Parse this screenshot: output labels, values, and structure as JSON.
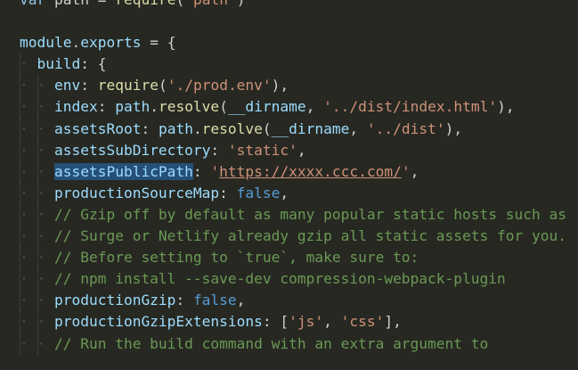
{
  "editor": {
    "theme_colors": {
      "background": "#272822",
      "property": "#9cdcfe",
      "string": "#ce9178",
      "function": "#dcdcaa",
      "boolean": "#569cd6",
      "comment": "#6a9955",
      "selection": "#264f78"
    },
    "lines": [
      {
        "id": "l0",
        "tokens": [
          {
            "t": "var",
            "c": "kw"
          },
          {
            "t": " path ",
            "c": "op"
          },
          {
            "t": "= ",
            "c": "op"
          },
          {
            "t": "require",
            "c": "fn"
          },
          {
            "t": "('",
            "c": "punc"
          },
          {
            "t": "path",
            "c": "str"
          },
          {
            "t": "')",
            "c": "punc"
          }
        ]
      },
      {
        "id": "l1",
        "tokens": []
      },
      {
        "id": "l2",
        "tokens": [
          {
            "t": "module",
            "c": "prop"
          },
          {
            "t": ".",
            "c": "punc"
          },
          {
            "t": "exports",
            "c": "prop"
          },
          {
            "t": " = {",
            "c": "op"
          }
        ]
      },
      {
        "id": "l3",
        "indent": 1,
        "tokens": [
          {
            "t": "build",
            "c": "prop"
          },
          {
            "t": ": {",
            "c": "punc"
          }
        ]
      },
      {
        "id": "l4",
        "indent": 2,
        "tokens": [
          {
            "t": "env",
            "c": "prop"
          },
          {
            "t": ": ",
            "c": "punc"
          },
          {
            "t": "require",
            "c": "fn"
          },
          {
            "t": "(",
            "c": "punc"
          },
          {
            "t": "'./prod.env'",
            "c": "str"
          },
          {
            "t": "),",
            "c": "punc"
          }
        ]
      },
      {
        "id": "l5",
        "indent": 2,
        "tokens": [
          {
            "t": "index",
            "c": "prop"
          },
          {
            "t": ": ",
            "c": "punc"
          },
          {
            "t": "path",
            "c": "prop"
          },
          {
            "t": ".",
            "c": "punc"
          },
          {
            "t": "resolve",
            "c": "fn"
          },
          {
            "t": "(",
            "c": "punc"
          },
          {
            "t": "__dirname",
            "c": "prop"
          },
          {
            "t": ", ",
            "c": "punc"
          },
          {
            "t": "'../dist/index.html'",
            "c": "str"
          },
          {
            "t": "),",
            "c": "punc"
          }
        ]
      },
      {
        "id": "l6",
        "indent": 2,
        "tokens": [
          {
            "t": "assetsRoot",
            "c": "prop"
          },
          {
            "t": ": ",
            "c": "punc"
          },
          {
            "t": "path",
            "c": "prop"
          },
          {
            "t": ".",
            "c": "punc"
          },
          {
            "t": "resolve",
            "c": "fn"
          },
          {
            "t": "(",
            "c": "punc"
          },
          {
            "t": "__dirname",
            "c": "prop"
          },
          {
            "t": ", ",
            "c": "punc"
          },
          {
            "t": "'../dist'",
            "c": "str"
          },
          {
            "t": "),",
            "c": "punc"
          }
        ]
      },
      {
        "id": "l7",
        "indent": 2,
        "tokens": [
          {
            "t": "assetsSubDirectory",
            "c": "prop"
          },
          {
            "t": ": ",
            "c": "punc"
          },
          {
            "t": "'static'",
            "c": "str"
          },
          {
            "t": ",",
            "c": "punc"
          }
        ]
      },
      {
        "id": "l8",
        "indent": 2,
        "tokens": [
          {
            "t": "assetsPublicPath",
            "c": "sel"
          },
          {
            "t": ": ",
            "c": "punc"
          },
          {
            "t": "'",
            "c": "str"
          },
          {
            "t": "https://xxxx.ccc.com/",
            "c": "url"
          },
          {
            "t": "'",
            "c": "str"
          },
          {
            "t": ",",
            "c": "punc"
          }
        ]
      },
      {
        "id": "l9",
        "indent": 2,
        "tokens": [
          {
            "t": "productionSourceMap",
            "c": "prop"
          },
          {
            "t": ": ",
            "c": "punc"
          },
          {
            "t": "false",
            "c": "bool"
          },
          {
            "t": ",",
            "c": "punc"
          }
        ]
      },
      {
        "id": "l10",
        "indent": 2,
        "tokens": [
          {
            "t": "// Gzip off by default as many popular static hosts such as",
            "c": "cmt"
          }
        ]
      },
      {
        "id": "l11",
        "indent": 2,
        "tokens": [
          {
            "t": "// Surge or Netlify already gzip all static assets for you.",
            "c": "cmt"
          }
        ]
      },
      {
        "id": "l12",
        "indent": 2,
        "tokens": [
          {
            "t": "// Before setting to `true`, make sure to:",
            "c": "cmt"
          }
        ]
      },
      {
        "id": "l13",
        "indent": 2,
        "tokens": [
          {
            "t": "// npm install --save-dev compression-webpack-plugin",
            "c": "cmt"
          }
        ]
      },
      {
        "id": "l14",
        "indent": 2,
        "tokens": [
          {
            "t": "productionGzip",
            "c": "prop"
          },
          {
            "t": ": ",
            "c": "punc"
          },
          {
            "t": "false",
            "c": "bool"
          },
          {
            "t": ",",
            "c": "punc"
          }
        ]
      },
      {
        "id": "l15",
        "indent": 2,
        "tokens": [
          {
            "t": "productionGzipExtensions",
            "c": "prop"
          },
          {
            "t": ": [",
            "c": "punc"
          },
          {
            "t": "'js'",
            "c": "str"
          },
          {
            "t": ", ",
            "c": "punc"
          },
          {
            "t": "'css'",
            "c": "str"
          },
          {
            "t": "],",
            "c": "punc"
          }
        ]
      },
      {
        "id": "l16",
        "indent": 2,
        "tokens": [
          {
            "t": "// Run the build command with an extra argument to",
            "c": "cmt"
          }
        ]
      }
    ]
  }
}
